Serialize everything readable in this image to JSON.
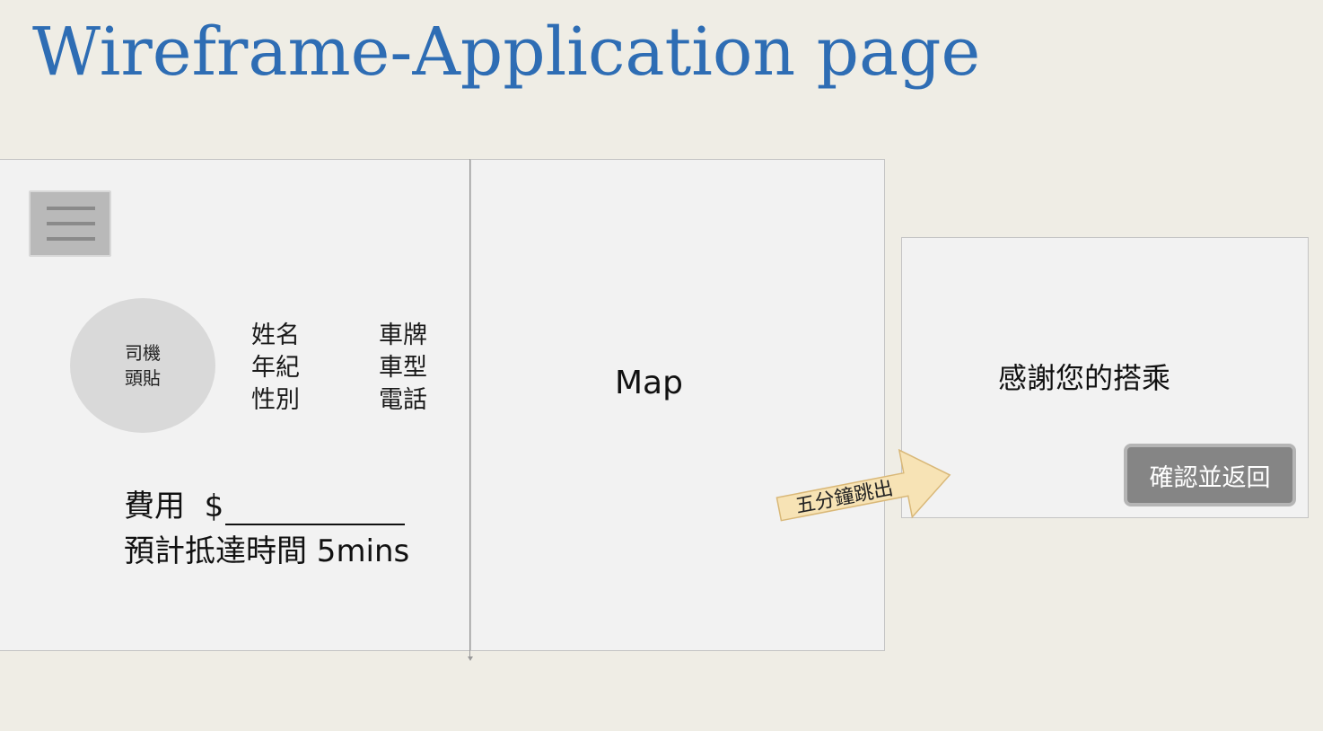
{
  "page_title": "Wireframe-Application page",
  "driver_panel": {
    "avatar_label": "司機\n頭貼",
    "info_left": [
      "姓名",
      "年紀",
      "性別"
    ],
    "info_right": [
      "車牌",
      "車型",
      "電話"
    ],
    "fee_label": "費用  $",
    "eta_label": "預計抵達時間 5mins"
  },
  "map_panel": {
    "label": "Map"
  },
  "transition": {
    "arrow_label": "五分鐘跳出",
    "arrow_color": "#f7e3b5"
  },
  "thanks_panel": {
    "message": "感謝您的搭乘",
    "confirm_button_label": "確認並返回"
  },
  "colors": {
    "title": "#2e6db4",
    "background": "#efede5",
    "panel": "#f2f2f2",
    "button": "#858585"
  },
  "icons": {
    "menu": "hamburger-menu-icon",
    "arrow": "right-arrow-icon"
  }
}
